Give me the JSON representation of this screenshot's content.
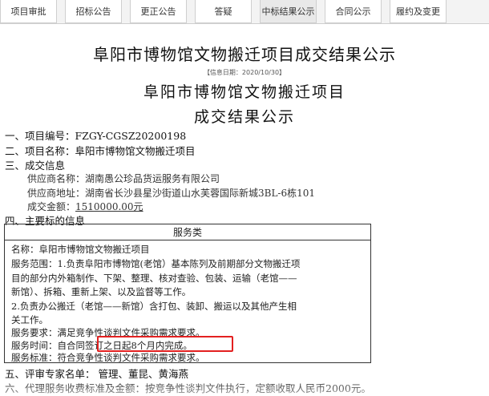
{
  "tabs": [
    {
      "label": "项目审批"
    },
    {
      "label": "招标公告"
    },
    {
      "label": "更正公告"
    },
    {
      "label": "答疑"
    },
    {
      "label": "中标结果公示",
      "active": true
    },
    {
      "label": "合同公示"
    },
    {
      "label": "履约及变更"
    }
  ],
  "page_title": "阜阳市博物馆文物搬迁项目成交结果公示",
  "info_date": "【信息日期：2020/10/30】",
  "doc_title_line1": "阜阳市博物馆文物搬迁项目",
  "doc_title_line2": "成交结果公示",
  "sections": {
    "project_no": "一、项目编号：FZGY-CGSZ20200198",
    "project_name": "二、项目名称：阜阳市博物馆文物搬迁项目",
    "deal_info": "三、成交信息",
    "supplier_name": "供应商名称：湖南愚公珍品货运服务有限公司",
    "supplier_address": "供应商地址：湖南省长沙县星沙街道山水芙蓉国际新城3BL-6栋101",
    "deal_amount_label": "成交金额：",
    "deal_amount_value": "1510000.00元",
    "main_subject": "四、主要标的信息",
    "experts": "五、评审专家名单：  管理、董昆、黄海燕",
    "agency_fee": "六、代理服务收费标准及金额：按竞争性谈判文件执行，定额收取人民币2000元。"
  },
  "service_box": {
    "header": "服务类",
    "lines": [
      "名称：阜阳市博物馆文物搬迁项目",
      "服务范围：1.负责阜阳市博物馆(老馆）基本陈列及前期部分文物搬迁项",
      "目的部分内外箱制作、下架、整理、核对查验、包装、运输（老馆——",
      "新馆）、拆箱、重新上架、以及监督等工作。",
      "2.负责办公搬迁（老馆——新馆）含打包、装卸、搬运以及其他产生相",
      "关工作。",
      "服务要求：满足竞争性谈判文件采购需求要求。",
      "服务时间：自合同签订之日起8个月内完成。",
      "服务标准：符合竞争性谈判文件采购需求要求。"
    ]
  }
}
